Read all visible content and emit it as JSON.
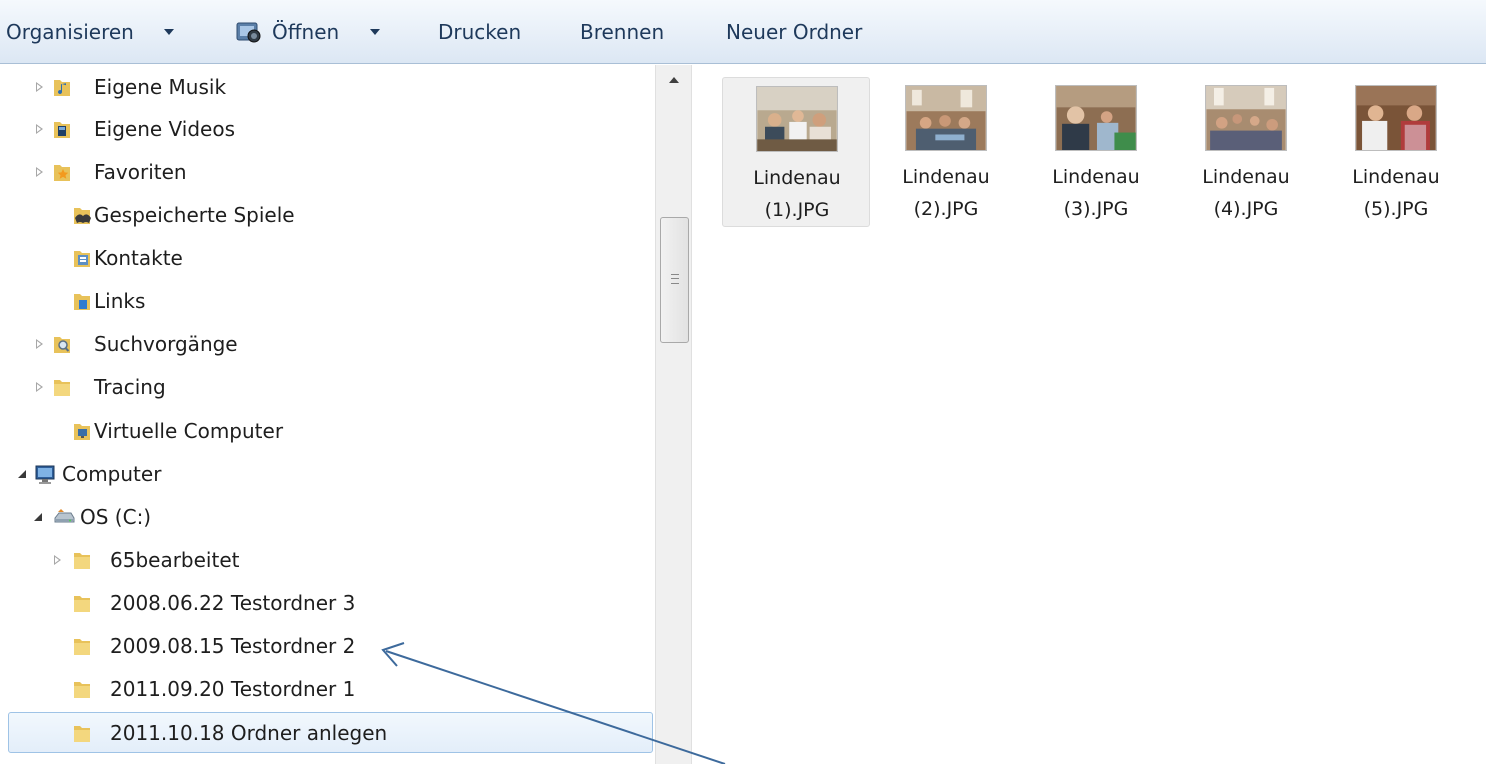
{
  "toolbar": {
    "organize_label": "Organisieren",
    "open_label": "Öffnen",
    "print_label": "Drucken",
    "burn_label": "Brennen",
    "new_folder_label": "Neuer Ordner"
  },
  "nav": {
    "items": [
      {
        "label": "Eigene Musik",
        "expander": "closed",
        "icon": "music-folder-icon"
      },
      {
        "label": "Eigene Videos",
        "expander": "closed",
        "icon": "videos-folder-icon"
      },
      {
        "label": "Favoriten",
        "expander": "closed",
        "icon": "favorites-folder-icon"
      },
      {
        "label": "Gespeicherte Spiele",
        "expander": "none",
        "icon": "saved-games-icon"
      },
      {
        "label": "Kontakte",
        "expander": "none",
        "icon": "contacts-folder-icon"
      },
      {
        "label": "Links",
        "expander": "none",
        "icon": "links-folder-icon"
      },
      {
        "label": "Suchvorgänge",
        "expander": "closed",
        "icon": "searches-folder-icon"
      },
      {
        "label": "Tracing",
        "expander": "closed",
        "icon": "folder-icon"
      },
      {
        "label": "Virtuelle Computer",
        "expander": "none",
        "icon": "virtual-computers-icon"
      },
      {
        "label": "Computer",
        "expander": "open",
        "icon": "computer-icon"
      },
      {
        "label": "OS (C:)",
        "expander": "open",
        "icon": "drive-icon"
      },
      {
        "label": "65bearbeitet",
        "expander": "closed",
        "icon": "folder-icon"
      },
      {
        "label": "2008.06.22 Testordner 3",
        "expander": "none",
        "icon": "folder-icon"
      },
      {
        "label": "2009.08.15 Testordner 2",
        "expander": "none",
        "icon": "folder-icon"
      },
      {
        "label": "2011.09.20 Testordner 1",
        "expander": "none",
        "icon": "folder-icon"
      },
      {
        "label": "2011.10.18 Ordner anlegen",
        "expander": "none",
        "icon": "folder-icon",
        "selected": true
      }
    ]
  },
  "files": [
    {
      "line1": "Lindenau",
      "line2": "(1).JPG",
      "selected": true
    },
    {
      "line1": "Lindenau",
      "line2": "(2).JPG"
    },
    {
      "line1": "Lindenau",
      "line2": "(3).JPG"
    },
    {
      "line1": "Lindenau",
      "line2": "(4).JPG"
    },
    {
      "line1": "Lindenau",
      "line2": "(5).JPG"
    }
  ],
  "colors": {
    "toolbar_text": "#1e395b",
    "selection_border": "#9fc3e6",
    "annotation_arrow": "#3d6a9c",
    "folder_yellow": "#e8c25a"
  }
}
